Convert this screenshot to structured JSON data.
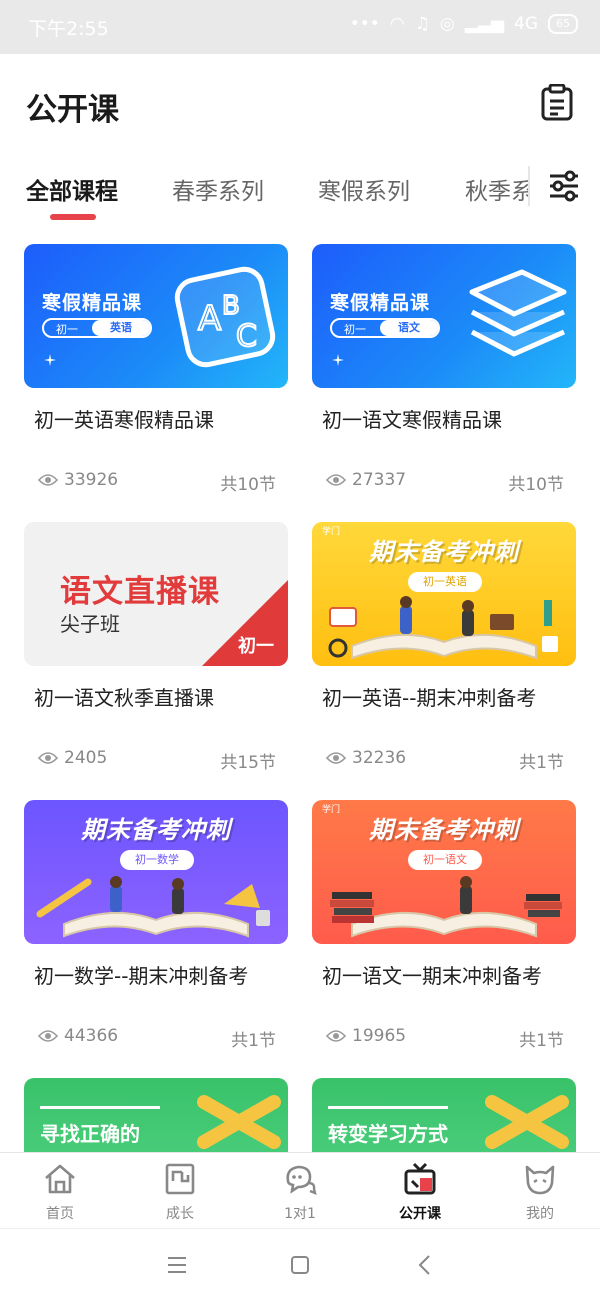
{
  "status_bar": {
    "time": "下午2:55",
    "network": "4G",
    "battery": "65"
  },
  "header": {
    "title": "公开课"
  },
  "tabs": [
    {
      "label": "全部课程"
    },
    {
      "label": "春季系列"
    },
    {
      "label": "寒假系列"
    },
    {
      "label": "秋季系列"
    }
  ],
  "thumbs": {
    "winter_title": "寒假精品课",
    "grade": "初一",
    "english": "英语",
    "chinese": "语文",
    "live_title": "语文直播课",
    "live_sub": "尖子班",
    "promo_headline": "期末备考冲刺",
    "chip_english": "初一英语",
    "chip_math": "初一数学",
    "chip_chinese": "初一语文",
    "logo": "学门",
    "green1": "寻找正确的",
    "green2": "转变学习方式"
  },
  "courses": [
    {
      "title": "初一英语寒假精品课",
      "views": "33926",
      "lessons": "共10节"
    },
    {
      "title": "初一语文寒假精品课",
      "views": "27337",
      "lessons": "共10节"
    },
    {
      "title": "初一语文秋季直播课",
      "views": "2405",
      "lessons": "共15节"
    },
    {
      "title": "初一英语--期末冲刺备考",
      "views": "32236",
      "lessons": "共1节"
    },
    {
      "title": "初一数学--期末冲刺备考",
      "views": "44366",
      "lessons": "共1节"
    },
    {
      "title": "初一语文一期末冲刺备考",
      "views": "19965",
      "lessons": "共1节"
    }
  ],
  "bottom_nav": [
    {
      "label": "首页"
    },
    {
      "label": "成长"
    },
    {
      "label": "1对1"
    },
    {
      "label": "公开课"
    },
    {
      "label": "我的"
    }
  ],
  "colors": {
    "accent": "#e8424b",
    "blue": "#1c8bf8",
    "yellow": "#ffc21a",
    "purple": "#7b5cff",
    "orange": "#ff6a4a",
    "green": "#44c877"
  }
}
